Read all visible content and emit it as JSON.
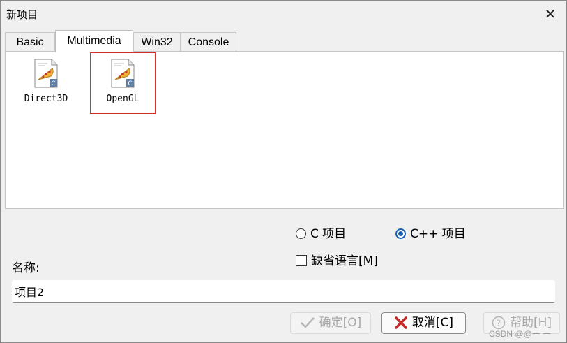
{
  "window": {
    "title": "新项目",
    "close_glyph": "✕"
  },
  "tabs": [
    {
      "label": "Basic"
    },
    {
      "label": "Multimedia"
    },
    {
      "label": "Win32"
    },
    {
      "label": "Console"
    }
  ],
  "templates": [
    {
      "label": "Direct3D",
      "icon": "pizza-c-file-icon",
      "selected": false
    },
    {
      "label": "OpenGL",
      "icon": "pizza-c-file-icon",
      "selected": true
    }
  ],
  "language": {
    "c_label": "C 项目",
    "cpp_label": "C++ 项目",
    "selected": "cpp",
    "default_lang_label": "缺省语言[M]",
    "default_lang_checked": false
  },
  "name": {
    "label": "名称:",
    "value": "项目2"
  },
  "buttons": {
    "ok": "确定[O]",
    "cancel": "取消[C]",
    "help": "帮助[H]"
  },
  "watermark": "CSDN @@一 一",
  "colors": {
    "selection_border": "#d32f2f",
    "radio_accent": "#1a63b8",
    "cancel_x": "#c62828"
  }
}
